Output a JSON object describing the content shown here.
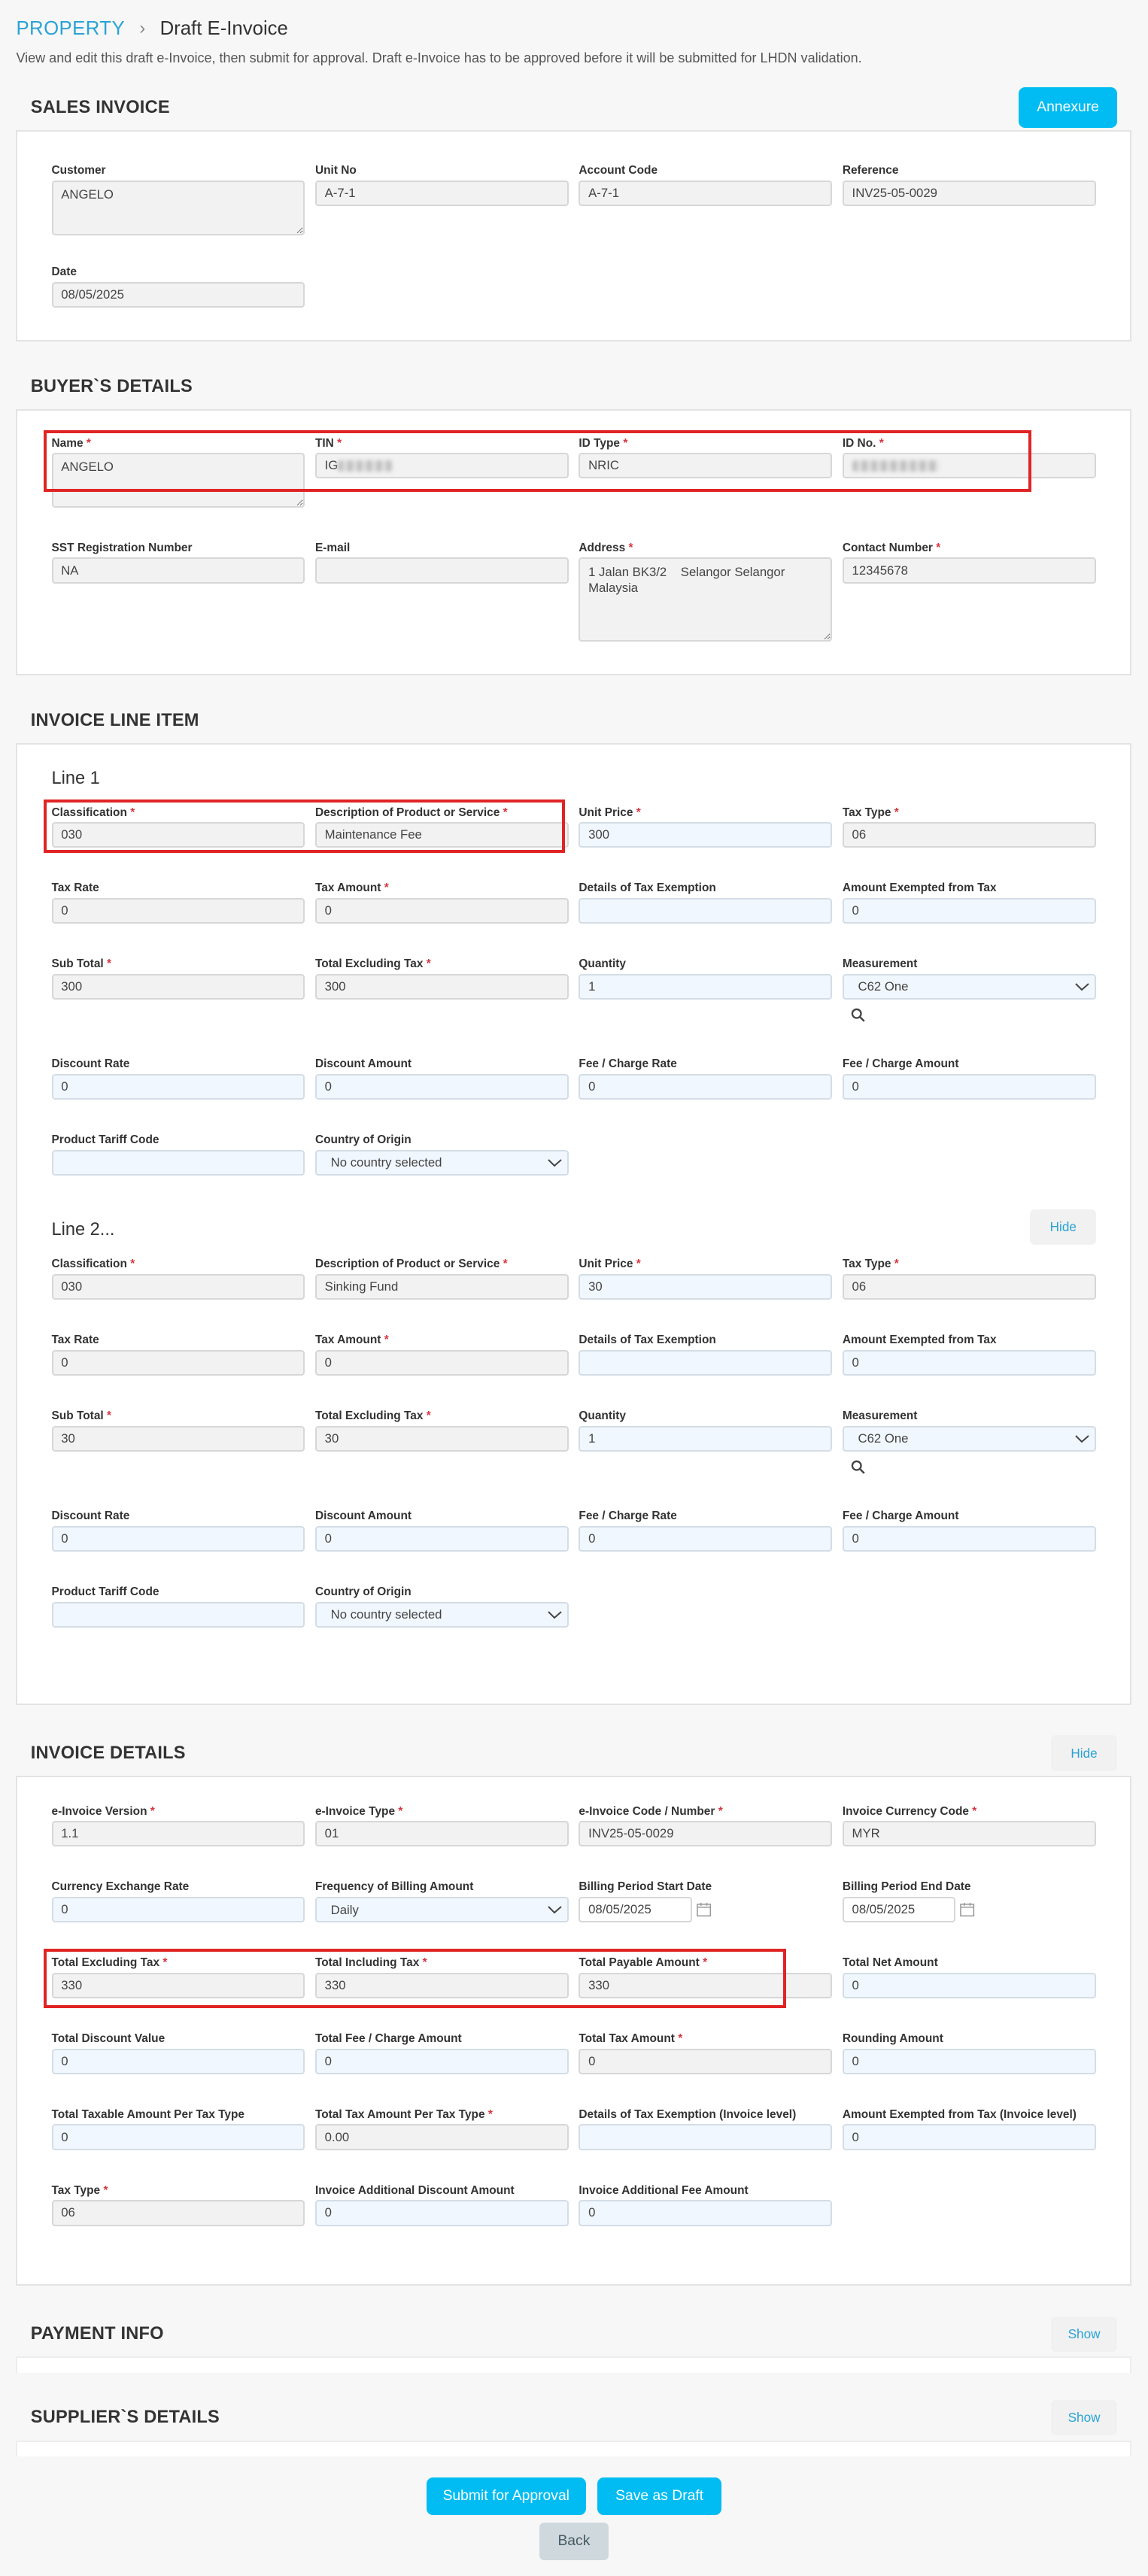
{
  "breadcrumb": {
    "root": "PROPERTY",
    "current": "Draft E-Invoice"
  },
  "subtitle": "View and edit this draft e-Invoice, then submit for approval. Draft e-Invoice has to be approved before it will be submitted for LHDN validation.",
  "sales_invoice": {
    "title": "SALES INVOICE",
    "annexure_label": "Annexure",
    "customer_label": "Customer",
    "customer": "ANGELO",
    "unit_no_label": "Unit No",
    "unit_no": "A-7-1",
    "account_code_label": "Account Code",
    "account_code": "A-7-1",
    "reference_label": "Reference",
    "reference": "INV25-05-0029",
    "date_label": "Date",
    "date": "08/05/2025"
  },
  "buyer": {
    "title": "BUYER`S DETAILS",
    "name_label": "Name",
    "name": "ANGELO",
    "tin_label": "TIN",
    "tin": "IG",
    "id_type_label": "ID Type",
    "id_type": "NRIC",
    "id_no_label": "ID No.",
    "sst_label": "SST Registration Number",
    "sst": "NA",
    "email_label": "E-mail",
    "email": "",
    "address_label": "Address",
    "address": "1 Jalan BK3/2    Selangor Selangor Malaysia",
    "contact_label": "Contact Number",
    "contact": "12345678"
  },
  "line_items": {
    "title": "INVOICE LINE ITEM",
    "labels": {
      "classification": "Classification",
      "description": "Description of Product or Service",
      "unit_price": "Unit Price",
      "tax_type": "Tax Type",
      "tax_rate": "Tax Rate",
      "tax_amount": "Tax Amount",
      "tax_exemption": "Details of Tax Exemption",
      "amount_exempted": "Amount Exempted from Tax",
      "sub_total": "Sub Total",
      "total_excl_tax": "Total Excluding Tax",
      "quantity": "Quantity",
      "measurement": "Measurement",
      "discount_rate": "Discount Rate",
      "discount_amount": "Discount Amount",
      "fee_rate": "Fee / Charge Rate",
      "fee_amount": "Fee / Charge Amount",
      "tariff_code": "Product Tariff Code",
      "country_origin": "Country of Origin"
    },
    "lines": [
      {
        "title": "Line 1",
        "classification": "030",
        "description": "Maintenance Fee",
        "unit_price": "300",
        "tax_type": "06",
        "tax_rate": "0",
        "tax_amount": "0",
        "tax_exemption": "",
        "amount_exempted": "0",
        "sub_total": "300",
        "total_excl_tax": "300",
        "quantity": "1",
        "measurement": "C62    One",
        "discount_rate": "0",
        "discount_amount": "0",
        "fee_rate": "0",
        "fee_amount": "0",
        "tariff_code": "",
        "country_origin": "No country selected"
      },
      {
        "title": "Line 2...",
        "hide_label": "Hide",
        "classification": "030",
        "description": "Sinking Fund",
        "unit_price": "30",
        "tax_type": "06",
        "tax_rate": "0",
        "tax_amount": "0",
        "tax_exemption": "",
        "amount_exempted": "0",
        "sub_total": "30",
        "total_excl_tax": "30",
        "quantity": "1",
        "measurement": "C62    One",
        "discount_rate": "0",
        "discount_amount": "0",
        "fee_rate": "0",
        "fee_amount": "0",
        "tariff_code": "",
        "country_origin": "No country selected"
      }
    ]
  },
  "invoice_details": {
    "title": "INVOICE DETAILS",
    "hide_label": "Hide",
    "version_label": "e-Invoice Version",
    "version": "1.1",
    "type_label": "e-Invoice Type",
    "type": "01",
    "code_label": "e-Invoice Code / Number",
    "code": "INV25-05-0029",
    "currency_label": "Invoice Currency Code",
    "currency": "MYR",
    "exchange_label": "Currency Exchange Rate",
    "exchange": "0",
    "frequency_label": "Frequency of Billing Amount",
    "frequency": "Daily",
    "start_label": "Billing Period Start Date",
    "start": "08/05/2025",
    "end_label": "Billing Period End Date",
    "end": "08/05/2025",
    "total_excl_label": "Total Excluding Tax",
    "total_excl": "330",
    "total_incl_label": "Total Including Tax",
    "total_incl": "330",
    "total_payable_label": "Total Payable Amount",
    "total_payable": "330",
    "total_net_label": "Total Net Amount",
    "total_net": "0",
    "total_discount_label": "Total Discount Value",
    "total_discount": "0",
    "total_fee_label": "Total Fee / Charge Amount",
    "total_fee": "0",
    "total_tax_label": "Total Tax Amount",
    "total_tax": "0",
    "rounding_label": "Rounding Amount",
    "rounding": "0",
    "taxable_label": "Total Taxable Amount Per Tax Type",
    "taxable": "0",
    "tax_per_type_label": "Total Tax Amount Per Tax Type",
    "tax_per_type": "0.00",
    "exemption_label": "Details of Tax Exemption (Invoice level)",
    "exemption": "",
    "exempted_label": "Amount Exempted from Tax (Invoice level)",
    "exempted": "0",
    "tax_type_label": "Tax Type",
    "tax_type": "06",
    "add_discount_label": "Invoice Additional Discount Amount",
    "add_discount": "0",
    "add_fee_label": "Invoice Additional Fee Amount",
    "add_fee": "0"
  },
  "payment_info": {
    "title": "PAYMENT INFO",
    "show_label": "Show"
  },
  "supplier": {
    "title": "SUPPLIER`S DETAILS",
    "show_label": "Show"
  },
  "actions": {
    "submit": "Submit for Approval",
    "save": "Save as Draft",
    "back": "Back"
  },
  "icons": {
    "search": "search-icon",
    "calendar": "calendar-icon",
    "breadcrumb_sep": "chevron-right-icon"
  },
  "colors": {
    "accent": "#00bcf2",
    "link": "#29a3d6",
    "highlight": "#e02424"
  }
}
